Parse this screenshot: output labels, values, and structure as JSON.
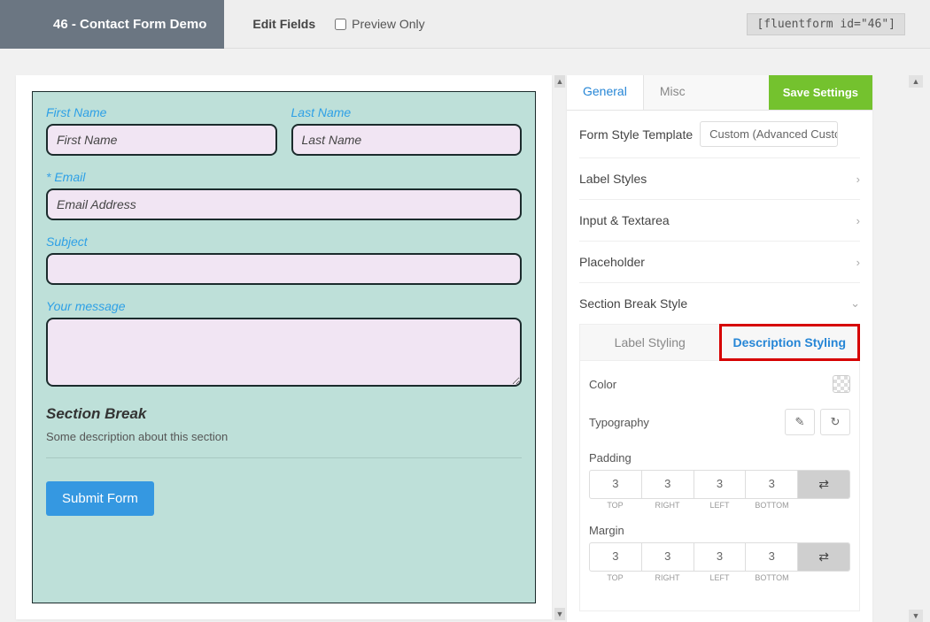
{
  "topbar": {
    "title": "46 - Contact Form Demo",
    "edit_fields": "Edit Fields",
    "preview_only": "Preview Only",
    "shortcode": "[fluentform id=\"46\"]"
  },
  "form": {
    "first_name_label": "First Name",
    "first_name_ph": "First Name",
    "last_name_label": "Last Name",
    "last_name_ph": "Last Name",
    "email_label": "Email",
    "required_mark": "*",
    "email_ph": "Email Address",
    "subject_label": "Subject",
    "message_label": "Your message",
    "section_title": "Section Break",
    "section_desc": "Some description about this section",
    "submit": "Submit Form"
  },
  "panel": {
    "tab_general": "General",
    "tab_misc": "Misc",
    "save": "Save Settings",
    "template_label": "Form Style Template",
    "template_value": "Custom (Advanced Custom",
    "acc_label_styles": "Label Styles",
    "acc_input": "Input & Textarea",
    "acc_placeholder": "Placeholder",
    "acc_section": "Section Break Style",
    "sub_label": "Label Styling",
    "sub_desc": "Description Styling",
    "prop_color": "Color",
    "prop_typo": "Typography",
    "prop_padding": "Padding",
    "prop_margin": "Margin",
    "spacing": {
      "top": "3",
      "right": "3",
      "left": "3",
      "bottom": "3",
      "cap_top": "TOP",
      "cap_right": "RIGHT",
      "cap_left": "LEFT",
      "cap_bottom": "BOTTOM"
    },
    "link_icon": "⇄"
  }
}
